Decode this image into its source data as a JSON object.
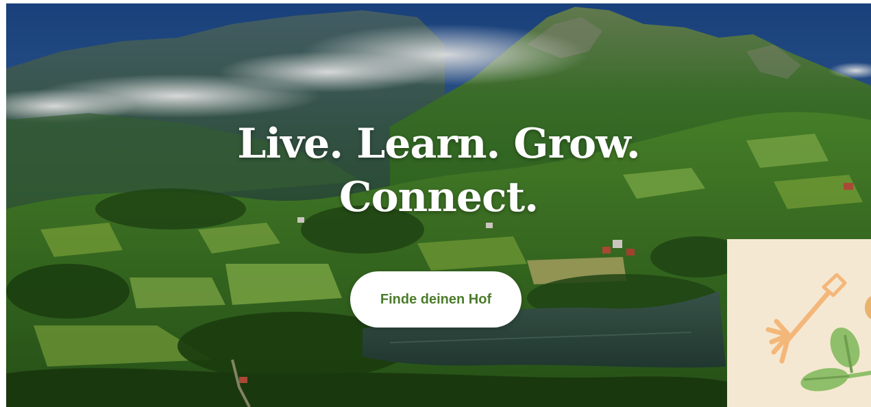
{
  "hero": {
    "headline_line1": "Live. Learn. Grow.",
    "headline_line2": "Connect.",
    "cta_label": "Finde deinen Hof"
  },
  "promo_card": {
    "icons": [
      "pitchfork-icon",
      "leaf-sprout-icon"
    ]
  },
  "colors": {
    "cta_text": "#4a7c2a",
    "cta_background": "#ffffff",
    "headline": "#ffffff",
    "promo_background": "#f5e8d2",
    "pitchfork": "#f4b77a",
    "leaf": "#8fbf6a"
  }
}
